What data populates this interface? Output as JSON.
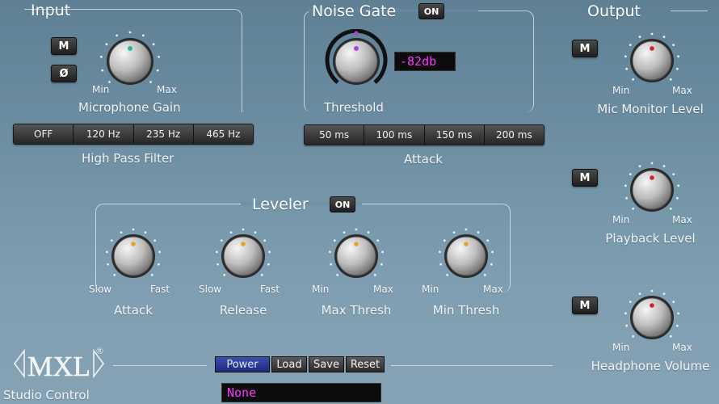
{
  "input": {
    "title": "Input",
    "mute_label": "M",
    "phase_label": "Ø",
    "gain_min": "Min",
    "gain_max": "Max",
    "gain_label": "Microphone Gain",
    "hpf_label": "High Pass Filter",
    "hpf_options": [
      "OFF",
      "120 Hz",
      "235 Hz",
      "465 Hz"
    ]
  },
  "noise_gate": {
    "title": "Noise Gate",
    "on_label": "ON",
    "threshold_label": "Threshold",
    "threshold_value": "-82db",
    "attack_label": "Attack",
    "attack_options": [
      "50 ms",
      "100 ms",
      "150 ms",
      "200 ms"
    ]
  },
  "leveler": {
    "title": "Leveler",
    "on_label": "ON",
    "knobs": [
      {
        "label": "Attack",
        "min": "Slow",
        "max": "Fast"
      },
      {
        "label": "Release",
        "min": "Slow",
        "max": "Fast"
      },
      {
        "label": "Max Thresh",
        "min": "Min",
        "max": "Max"
      },
      {
        "label": "Min Thresh",
        "min": "Min",
        "max": "Max"
      }
    ]
  },
  "output": {
    "title": "Output",
    "channels": [
      {
        "mute_label": "M",
        "min": "Min",
        "max": "Max",
        "label": "Mic Monitor Level"
      },
      {
        "mute_label": "M",
        "min": "Min",
        "max": "Max",
        "label": "Playback Level"
      },
      {
        "mute_label": "M",
        "min": "Min",
        "max": "Max",
        "label": "Headphone Volume"
      }
    ]
  },
  "footer": {
    "brand": "MXL",
    "registered": "®",
    "subtitle": "Studio Control",
    "buttons": [
      "Power",
      "Load",
      "Save",
      "Reset"
    ],
    "preset_value": "None"
  },
  "colors": {
    "knob_indicator_green": "#2fb58f",
    "knob_indicator_orange": "#e6a321",
    "knob_indicator_red": "#d4232a",
    "knob_indicator_purple": "#b23fd6",
    "readout_text": "#ff33ff"
  }
}
